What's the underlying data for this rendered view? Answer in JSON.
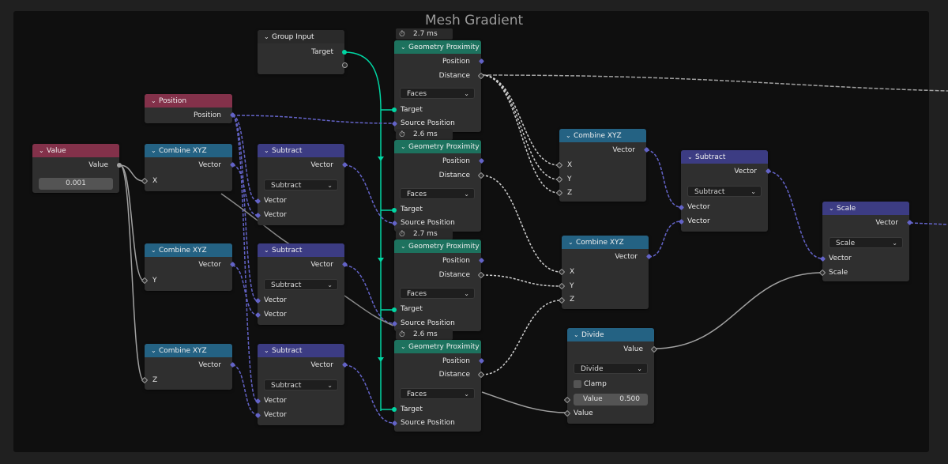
{
  "frame": {
    "title": "Mesh Gradient"
  },
  "colors": {
    "geometry_socket": "#00d6a3",
    "vector_socket": "#6363c7",
    "float_socket": "#a1a1a1",
    "input_header": "#83314a",
    "vector_header": "#246283",
    "geometry_header": "#1d725e",
    "math_header": "#3c3c83"
  },
  "nodes": {
    "group_input": {
      "title": "Group Input",
      "target": "Target"
    },
    "position": {
      "title": "Position",
      "out": "Position"
    },
    "value": {
      "title": "Value",
      "out": "Value",
      "field": "0.001"
    },
    "combine_x": {
      "title": "Combine XYZ",
      "out": "Vector",
      "in": "X"
    },
    "combine_y": {
      "title": "Combine XYZ",
      "out": "Vector",
      "in": "Y"
    },
    "combine_z": {
      "title": "Combine XYZ",
      "out": "Vector",
      "in": "Z"
    },
    "subtract_1": {
      "title": "Subtract",
      "out": "Vector",
      "mode": "Subtract",
      "in1": "Vector",
      "in2": "Vector"
    },
    "subtract_2": {
      "title": "Subtract",
      "out": "Vector",
      "mode": "Subtract",
      "in1": "Vector",
      "in2": "Vector"
    },
    "subtract_3": {
      "title": "Subtract",
      "out": "Vector",
      "mode": "Subtract",
      "in1": "Vector",
      "in2": "Vector"
    },
    "geo_1": {
      "timing": "2.7 ms",
      "title": "Geometry Proximity",
      "position": "Position",
      "distance": "Distance",
      "mode": "Faces",
      "target": "Target",
      "source": "Source Position"
    },
    "geo_2": {
      "timing": "2.6 ms",
      "title": "Geometry Proximity",
      "position": "Position",
      "distance": "Distance",
      "mode": "Faces",
      "target": "Target",
      "source": "Source Position"
    },
    "geo_3": {
      "timing": "2.7 ms",
      "title": "Geometry Proximity",
      "position": "Position",
      "distance": "Distance",
      "mode": "Faces",
      "target": "Target",
      "source": "Source Position"
    },
    "geo_4": {
      "timing": "2.6 ms",
      "title": "Geometry Proximity",
      "position": "Position",
      "distance": "Distance",
      "mode": "Faces",
      "target": "Target",
      "source": "Source Position"
    },
    "combine_a": {
      "title": "Combine XYZ",
      "out": "Vector",
      "x": "X",
      "y": "Y",
      "z": "Z"
    },
    "combine_b": {
      "title": "Combine XYZ",
      "out": "Vector",
      "x": "X",
      "y": "Y",
      "z": "Z"
    },
    "subtract_4": {
      "title": "Subtract",
      "out": "Vector",
      "mode": "Subtract",
      "in1": "Vector",
      "in2": "Vector"
    },
    "divide": {
      "title": "Divide",
      "out": "Value",
      "mode": "Divide",
      "clamp": "Clamp",
      "value_label": "Value",
      "value_num": "0.500",
      "in": "Value"
    },
    "scale": {
      "title": "Scale",
      "out": "Vector",
      "mode": "Scale",
      "in": "Vector",
      "scale": "Scale"
    }
  }
}
